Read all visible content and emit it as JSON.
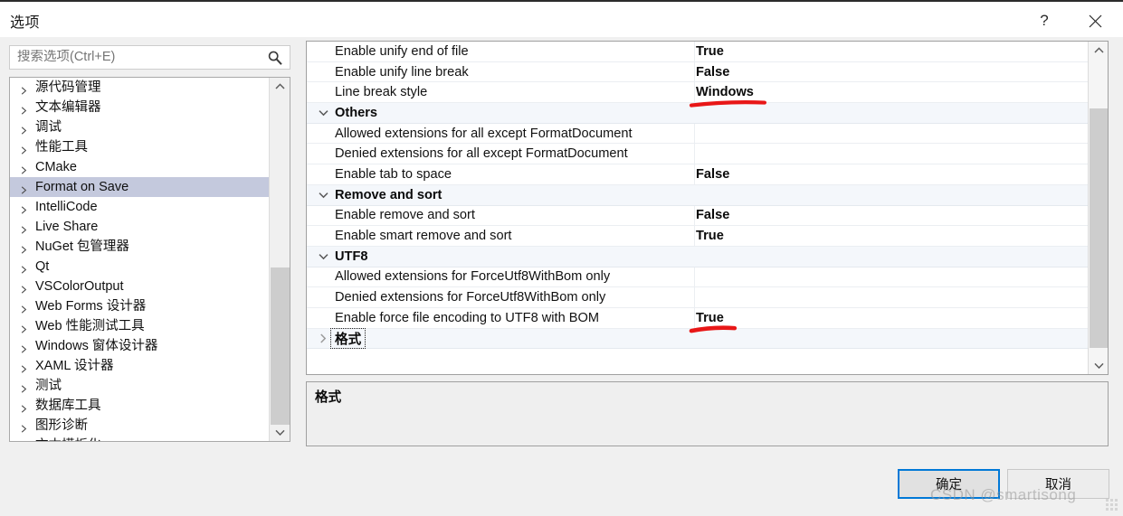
{
  "window": {
    "title": "选项",
    "help_label": "?",
    "close_label": "✕"
  },
  "search": {
    "placeholder": "搜索选项(Ctrl+E)",
    "value": "",
    "icon": "search-icon"
  },
  "sidebar": {
    "items": [
      {
        "label": "源代码管理",
        "selected": false
      },
      {
        "label": "文本编辑器",
        "selected": false
      },
      {
        "label": "调试",
        "selected": false
      },
      {
        "label": "性能工具",
        "selected": false
      },
      {
        "label": "CMake",
        "selected": false
      },
      {
        "label": "Format on Save",
        "selected": true
      },
      {
        "label": "IntelliCode",
        "selected": false
      },
      {
        "label": "Live Share",
        "selected": false
      },
      {
        "label": "NuGet 包管理器",
        "selected": false
      },
      {
        "label": "Qt",
        "selected": false
      },
      {
        "label": "VSColorOutput",
        "selected": false
      },
      {
        "label": "Web Forms 设计器",
        "selected": false
      },
      {
        "label": "Web 性能测试工具",
        "selected": false
      },
      {
        "label": "Windows 窗体设计器",
        "selected": false
      },
      {
        "label": "XAML 设计器",
        "selected": false
      },
      {
        "label": "测试",
        "selected": false
      },
      {
        "label": "数据库工具",
        "selected": false
      },
      {
        "label": "图形诊断",
        "selected": false
      },
      {
        "label": "文本模板化",
        "selected": false
      }
    ]
  },
  "grid": {
    "rows": [
      {
        "type": "property",
        "name": "Enable unify end of file",
        "value": "True",
        "annotated": false
      },
      {
        "type": "property",
        "name": "Enable unify line break",
        "value": "False",
        "annotated": false
      },
      {
        "type": "property",
        "name": "Line break style",
        "value": "Windows",
        "annotated": true
      },
      {
        "type": "category",
        "name": "Others",
        "value": "",
        "expanded": true
      },
      {
        "type": "property",
        "name": "Allowed extensions for all except FormatDocument",
        "value": "",
        "annotated": false
      },
      {
        "type": "property",
        "name": "Denied extensions for all except FormatDocument",
        "value": "",
        "annotated": false
      },
      {
        "type": "property",
        "name": "Enable tab to space",
        "value": "False",
        "annotated": false
      },
      {
        "type": "category",
        "name": "Remove and sort",
        "value": "",
        "expanded": true
      },
      {
        "type": "property",
        "name": "Enable remove and sort",
        "value": "False",
        "annotated": false
      },
      {
        "type": "property",
        "name": "Enable smart remove and sort",
        "value": "True",
        "annotated": false
      },
      {
        "type": "category",
        "name": "UTF8",
        "value": "",
        "expanded": true
      },
      {
        "type": "property",
        "name": "Allowed extensions for ForceUtf8WithBom only",
        "value": "",
        "annotated": false
      },
      {
        "type": "property",
        "name": "Denied extensions for ForceUtf8WithBom only",
        "value": "",
        "annotated": false
      },
      {
        "type": "property",
        "name": "Enable force file encoding to UTF8 with BOM",
        "value": "True",
        "annotated": true
      },
      {
        "type": "category",
        "name": "格式",
        "value": "",
        "expanded": false,
        "focused": true
      }
    ]
  },
  "description": {
    "title": "格式"
  },
  "footer": {
    "ok_label": "确定",
    "cancel_label": "取消"
  },
  "annotation": {
    "color": "#e81717",
    "count": 2
  },
  "watermark": {
    "text": "CSDN @smartisong"
  }
}
